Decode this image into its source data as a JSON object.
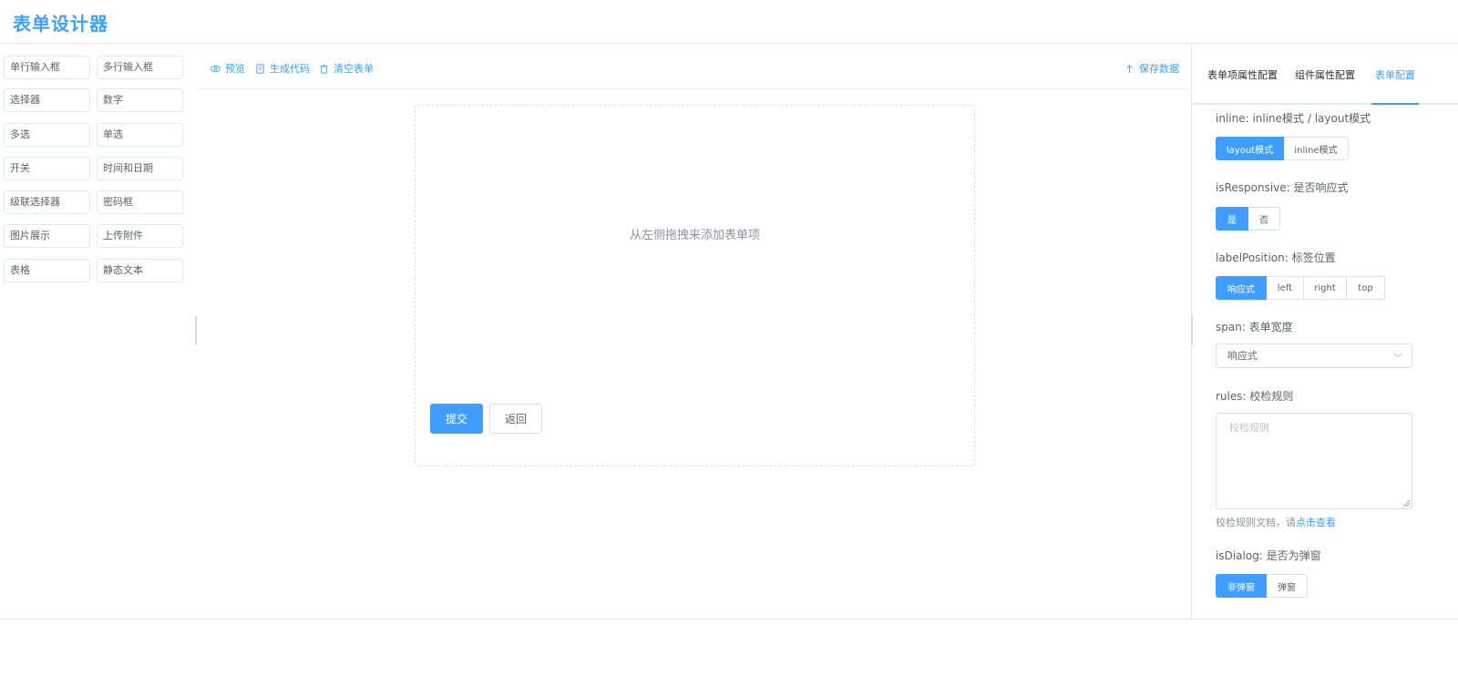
{
  "header": {
    "title": "表单设计器"
  },
  "components": [
    {
      "label": "单行输入框"
    },
    {
      "label": "多行输入框"
    },
    {
      "label": "选择器"
    },
    {
      "label": "数字"
    },
    {
      "label": "多选"
    },
    {
      "label": "单选"
    },
    {
      "label": "开关"
    },
    {
      "label": "时间和日期"
    },
    {
      "label": "级联选择器"
    },
    {
      "label": "密码框"
    },
    {
      "label": "图片展示"
    },
    {
      "label": "上传附件"
    },
    {
      "label": "表格"
    },
    {
      "label": "静态文本"
    }
  ],
  "toolbar": {
    "preview": "预览",
    "generate_code": "生成代码",
    "clear_form": "清空表单",
    "save_data": "保存数据"
  },
  "canvas": {
    "empty_tip": "从左侧拖拽来添加表单项",
    "submit_label": "提交",
    "back_label": "返回"
  },
  "tabs": [
    {
      "label": "表单项属性配置"
    },
    {
      "label": "组件属性配置"
    },
    {
      "label": "表单配置",
      "active": true
    }
  ],
  "config": {
    "inline_label": "inline: inline模式 / layout模式",
    "inline_options": [
      "layout模式",
      "inline模式"
    ],
    "inline_selected": "layout模式",
    "responsive_label": "isResponsive: 是否响应式",
    "responsive_options": [
      "是",
      "否"
    ],
    "responsive_selected": "是",
    "label_position_label": "labelPosition: 标签位置",
    "label_position_options": [
      "响应式",
      "left",
      "right",
      "top"
    ],
    "label_position_selected": "响应式",
    "span_label": "span: 表单宽度",
    "span_value": "响应式",
    "rules_label": "rules: 校检规则",
    "rules_placeholder": "校检规则",
    "rules_help": "校检规则文档，请",
    "rules_help_link": "点击查看",
    "dialog_label": "isDialog: 是否为弹窗",
    "dialog_options": [
      "非弹窗",
      "弹窗"
    ],
    "dialog_selected": "非弹窗"
  },
  "colors": {
    "accent": "#409eff",
    "border": "#dcdfe6",
    "text": "#606266"
  }
}
